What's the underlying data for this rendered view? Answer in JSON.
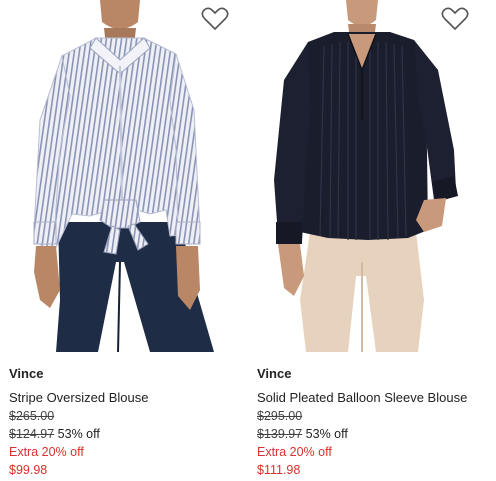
{
  "products": [
    {
      "brand": "Vince",
      "name": "Stripe Oversized Blouse",
      "original_price": "$265.00",
      "sale_price": "$124.97",
      "discount": "53% off",
      "extra_offer": "Extra 20% off",
      "final_price": "$99.98",
      "favorite_icon": "heart-outline-icon"
    },
    {
      "brand": "Vince",
      "name": "Solid Pleated Balloon Sleeve Blouse",
      "original_price": "$295.00",
      "sale_price": "$139.97",
      "discount": "53% off",
      "extra_offer": "Extra 20% off",
      "final_price": "$111.98",
      "favorite_icon": "heart-outline-icon"
    }
  ],
  "colors": {
    "sale_red": "#d9312b",
    "text": "#222222",
    "icon_stroke": "#555555"
  }
}
